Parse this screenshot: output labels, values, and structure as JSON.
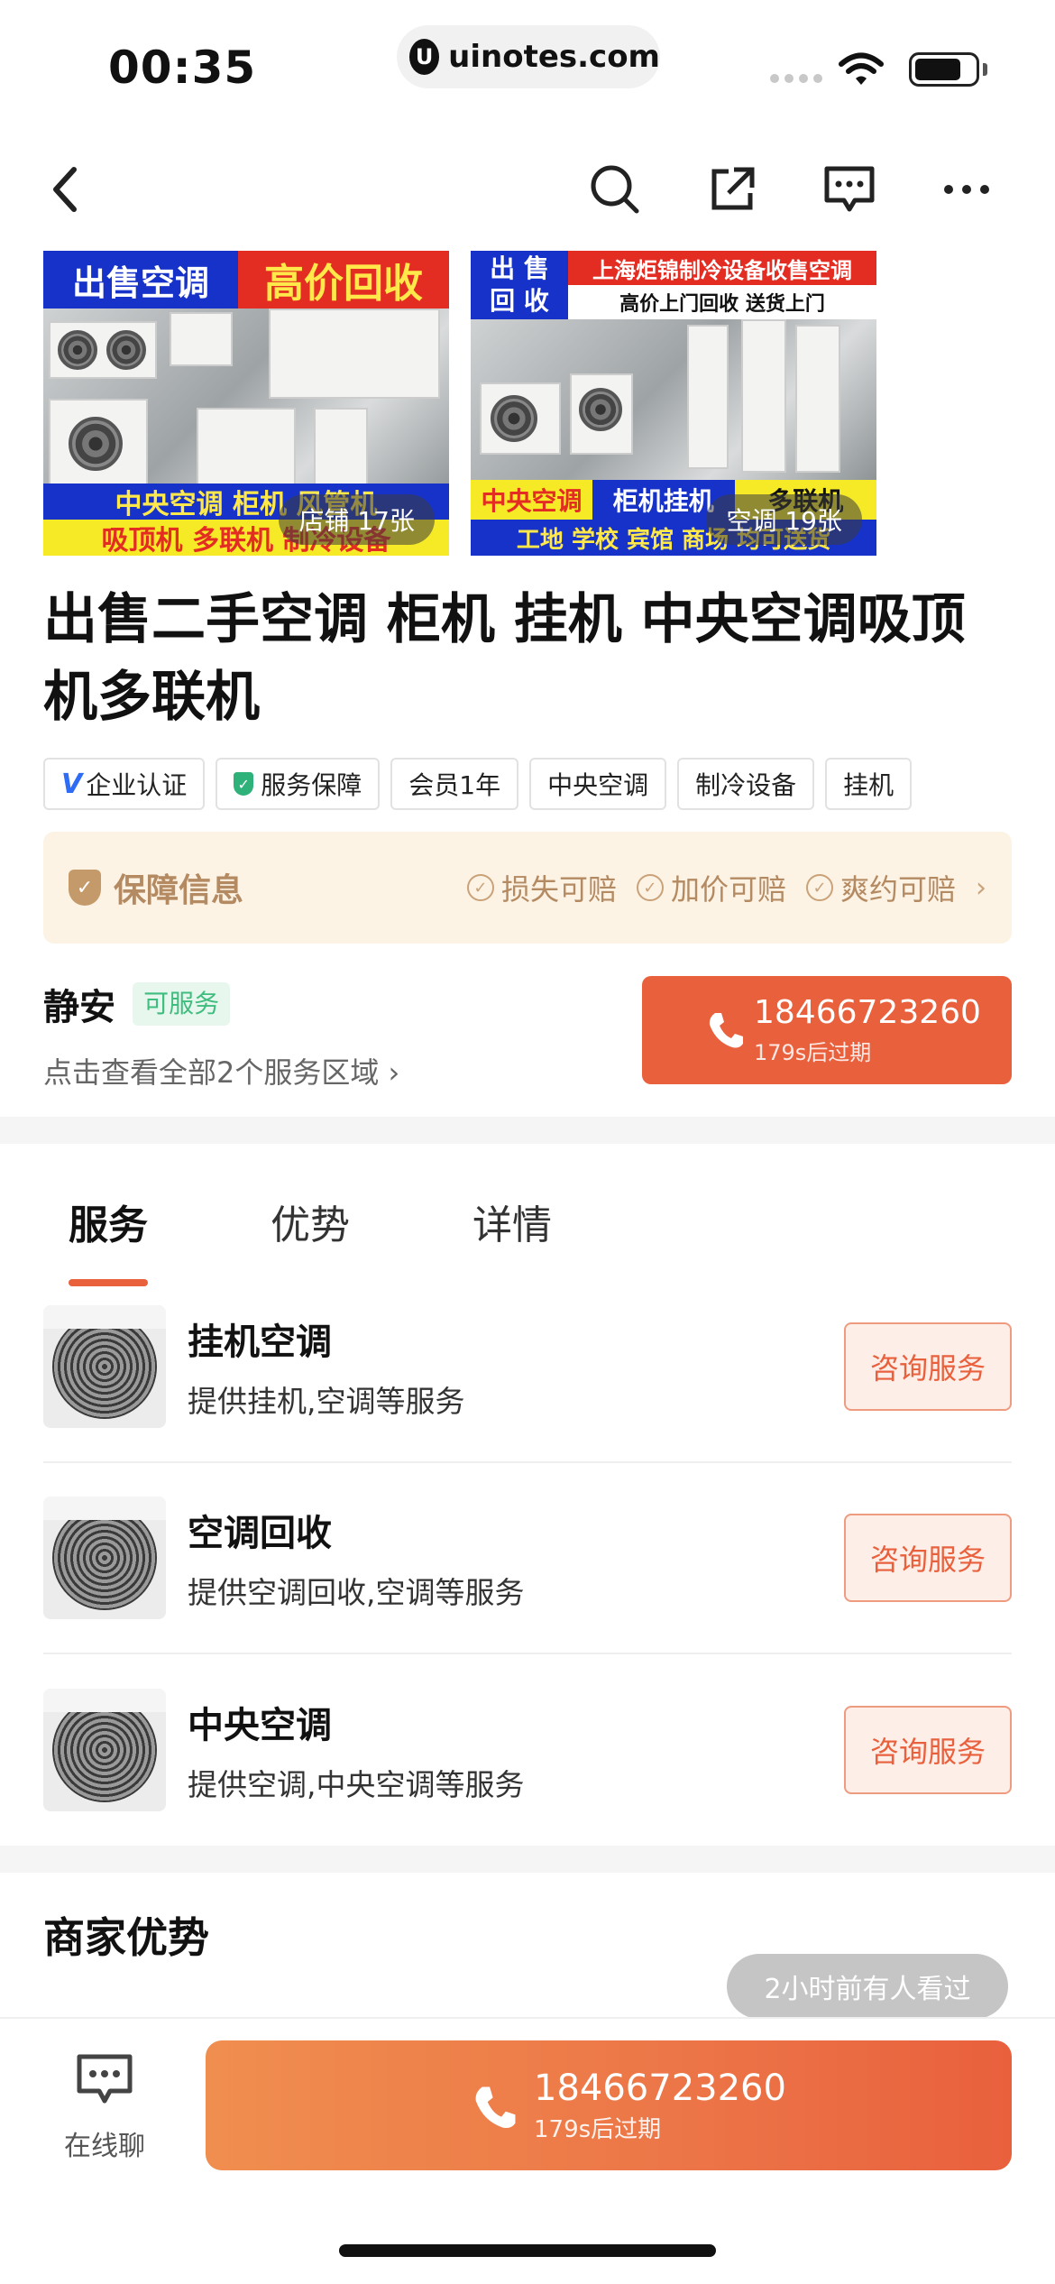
{
  "status_bar": {
    "time": "00:35",
    "url": "uinotes.com",
    "url_logo": "U"
  },
  "nav": {
    "back_icon": "chevron-left-icon",
    "icons": [
      "search-icon",
      "share-icon",
      "message-icon",
      "more-icon"
    ]
  },
  "gallery": [
    {
      "band_top_left": "出售空调",
      "band_top_right": "高价回收",
      "band_bottom_1": "中央空调 柜机 风管机",
      "band_bottom_2": "吸顶机 多联机 制冷设备",
      "count_label": "店铺 17张"
    },
    {
      "band_top_left_1": "出 售",
      "band_top_left_2": "回 收",
      "band_top_right_1": "上海炬锦制冷设备收售空调",
      "band_top_right_2": "高价上门回收  送货上门",
      "band_bottom_1": "中央空调",
      "band_bottom_2": "柜机挂机",
      "band_bottom_3": "多联机",
      "band_bottom_4": "工地 学校 宾馆 商场 均可送货",
      "count_label": "空调 19张"
    }
  ],
  "title": "出售二手空调 柜机 挂机 中央空调吸顶机多联机",
  "tags": [
    {
      "prefix": "V",
      "label": "企业认证"
    },
    {
      "prefix": "✓",
      "label": "服务保障"
    },
    {
      "prefix": "",
      "label": "会员1年"
    },
    {
      "prefix": "",
      "label": "中央空调"
    },
    {
      "prefix": "",
      "label": "制冷设备"
    },
    {
      "prefix": "",
      "label": "挂机"
    }
  ],
  "guarantee": {
    "title": "保障信息",
    "items": [
      "损失可赔",
      "加价可赔",
      "爽约可赔"
    ],
    "arrow": "›"
  },
  "area": {
    "name": "静安",
    "badge": "可服务",
    "sub": "点击查看全部2个服务区域 ›"
  },
  "phone": {
    "number": "18466723260",
    "expiry": "179s后过期"
  },
  "tabs": [
    "服务",
    "优势",
    "详情"
  ],
  "services": [
    {
      "name": "挂机空调",
      "desc": "提供挂机,空调等服务",
      "button": "咨询服务"
    },
    {
      "name": "空调回收",
      "desc": "提供空调回收,空调等服务",
      "button": "咨询服务"
    },
    {
      "name": "中央空调",
      "desc": "提供空调,中央空调等服务",
      "button": "咨询服务"
    }
  ],
  "merchant": {
    "title": "商家优势",
    "viewed": "2小时前有人看过"
  },
  "bottom": {
    "chat_label": "在线聊",
    "call_number": "18466723260",
    "call_expiry": "179s后过期"
  },
  "colors": {
    "accent": "#e9603d",
    "guarantee_bg": "#fdf3e4",
    "guarantee_text": "#b48a62",
    "badge_green": "#3fbd7e"
  }
}
